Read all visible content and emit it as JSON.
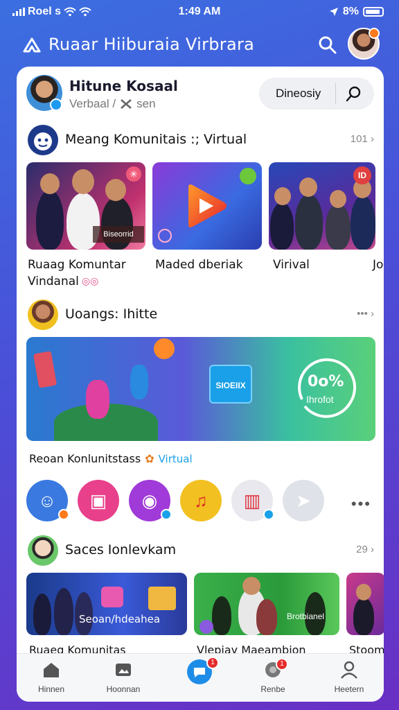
{
  "status": {
    "carrier": "Roel s",
    "time": "1:49 AM",
    "battery": "8%"
  },
  "header": {
    "title": "Ruaar Hiiburaia Virbrara"
  },
  "profile": {
    "name": "Hitune Kosaal",
    "sub_left": "Verbaal /",
    "sub_right": "sen",
    "search_label": "Dineosiy"
  },
  "section1": {
    "title": "Meang Komunitais :; Virtual",
    "count": "101",
    "cards": [
      {
        "label": "Ruaag Komuntar",
        "label2": "Vindanal",
        "overlay": "Biseorrid"
      },
      {
        "label": "Maded dberiak"
      },
      {
        "label": "Virival",
        "overlay": "ID"
      },
      {
        "label": "Jo"
      }
    ]
  },
  "section2": {
    "title": "Uoangs: Ihitte",
    "banner_tag": "SIOEIIX",
    "banner_percent": "0o%",
    "banner_sub": "Ihrofot",
    "caption": "Reoan Konlunitstass",
    "caption_accent": "Virtual"
  },
  "section3": {
    "title": "Saces Ionlevkam",
    "count": "29",
    "cards": [
      {
        "label": "Ruaeg Komunitas",
        "overlay": "Seoan/hdeahea"
      },
      {
        "label": "Vlepiay Maeambion",
        "overlay": "Brotbianel"
      },
      {
        "label": "Stoom"
      }
    ]
  },
  "nav": {
    "items": [
      {
        "label": "Hinnen"
      },
      {
        "label": "Hoonnan"
      },
      {
        "label": "Renbe"
      },
      {
        "label": "Heetern"
      }
    ],
    "badge1": "1",
    "badge2": "1"
  },
  "colors": {
    "accent": "#1e8de8",
    "badge": "#e52b2b",
    "background_top": "#3b6fe0",
    "background_bottom": "#6a2fc4"
  }
}
